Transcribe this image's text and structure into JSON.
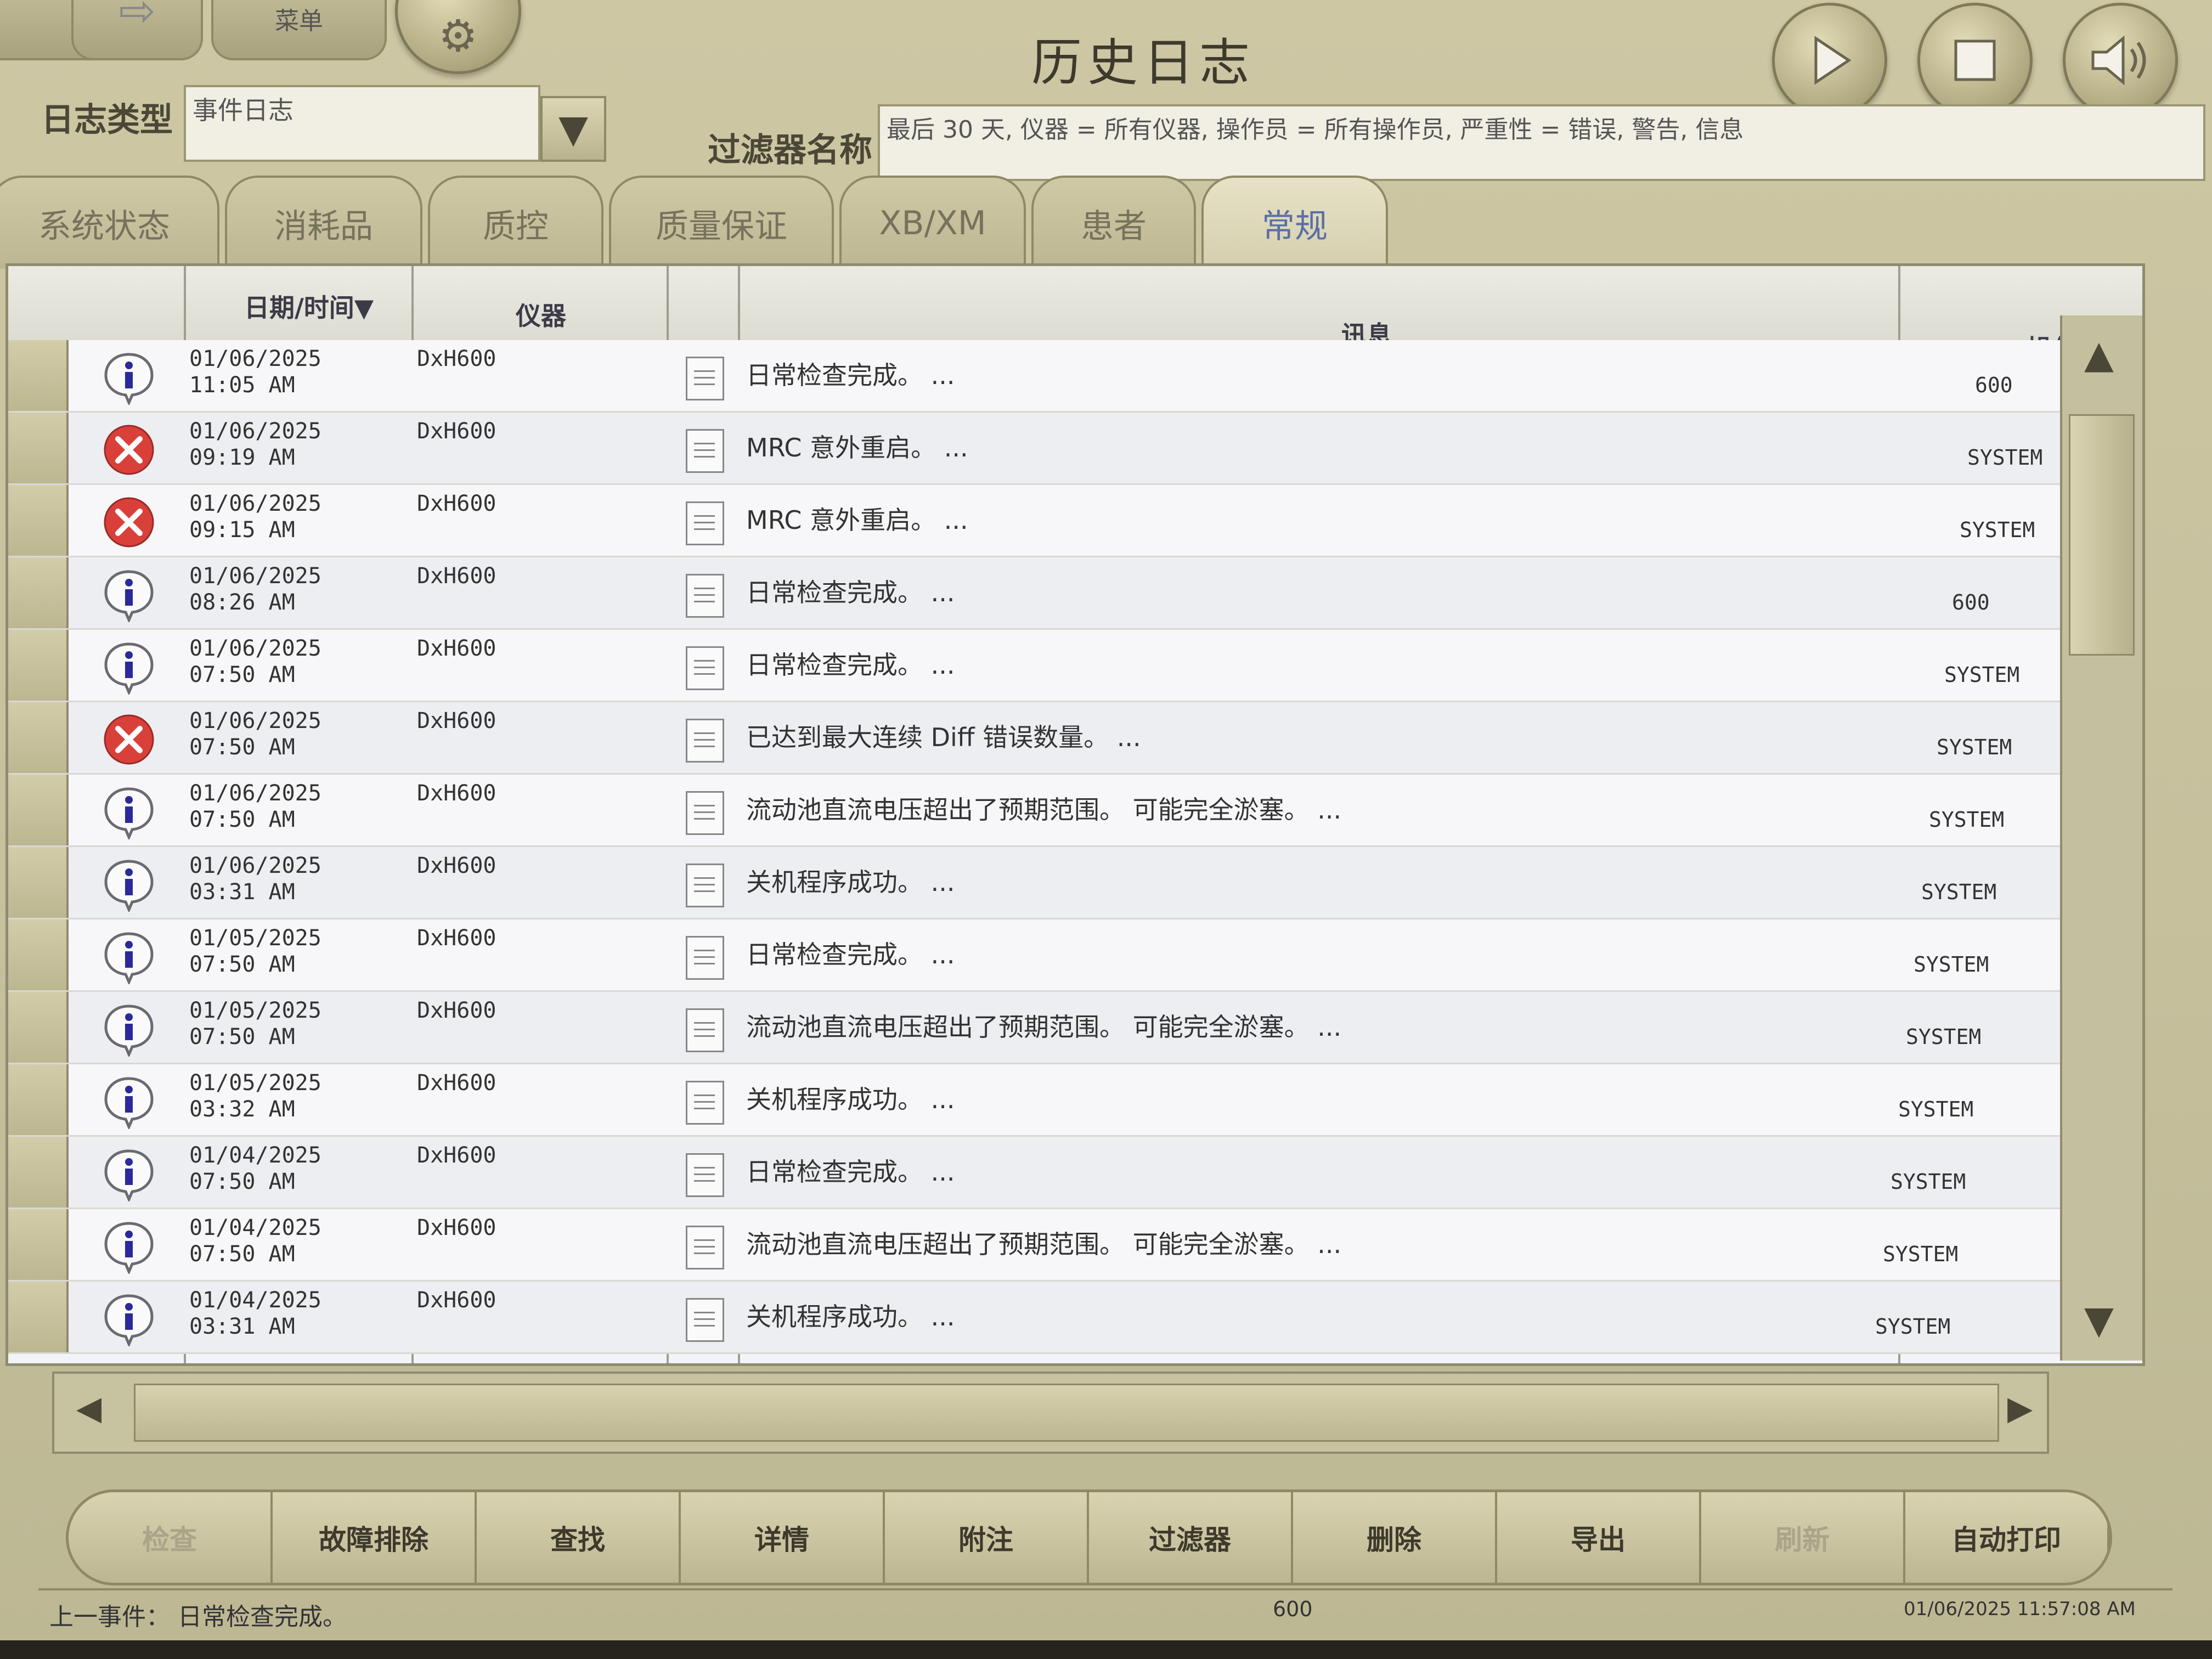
{
  "header": {
    "title": "历史日志",
    "menu_partial_label": "菜单",
    "log_type_label": "日志类型",
    "log_type_value": "事件日志",
    "filter_name_label": "过滤器名称",
    "filter_value": "最后 30 天, 仪器 = 所有仪器, 操作员 = 所有操作员, 严重性 = 错误, 警告, 信息"
  },
  "tabs": [
    {
      "label": "系统状态"
    },
    {
      "label": "消耗品"
    },
    {
      "label": "质控"
    },
    {
      "label": "质量保证"
    },
    {
      "label": "XB/XM"
    },
    {
      "label": "患者"
    },
    {
      "label": "常规"
    }
  ],
  "table": {
    "columns": {
      "datetime": "日期/时间▼",
      "instrument": "仪器",
      "message": "讯息",
      "operator": "操作员"
    },
    "rows": [
      {
        "severity": "info",
        "date": "01/06/2025",
        "time": "11:05 AM",
        "instrument": "DxH600",
        "message": "日常检查完成。 ...",
        "operator": "600"
      },
      {
        "severity": "error",
        "date": "01/06/2025",
        "time": "09:19 AM",
        "instrument": "DxH600",
        "message": "MRC 意外重启。 ...",
        "operator": "SYSTEM"
      },
      {
        "severity": "error",
        "date": "01/06/2025",
        "time": "09:15 AM",
        "instrument": "DxH600",
        "message": "MRC 意外重启。 ...",
        "operator": "SYSTEM"
      },
      {
        "severity": "info",
        "date": "01/06/2025",
        "time": "08:26 AM",
        "instrument": "DxH600",
        "message": "日常检查完成。 ...",
        "operator": "600"
      },
      {
        "severity": "info",
        "date": "01/06/2025",
        "time": "07:50 AM",
        "instrument": "DxH600",
        "message": "日常检查完成。 ...",
        "operator": "SYSTEM"
      },
      {
        "severity": "error",
        "date": "01/06/2025",
        "time": "07:50 AM",
        "instrument": "DxH600",
        "message": "已达到最大连续 Diff 错误数量。 ...",
        "operator": "SYSTEM"
      },
      {
        "severity": "info",
        "date": "01/06/2025",
        "time": "07:50 AM",
        "instrument": "DxH600",
        "message": "流动池直流电压超出了预期范围。 可能完全淤塞。 ...",
        "operator": "SYSTEM"
      },
      {
        "severity": "info",
        "date": "01/06/2025",
        "time": "03:31 AM",
        "instrument": "DxH600",
        "message": "关机程序成功。 ...",
        "operator": "SYSTEM"
      },
      {
        "severity": "info",
        "date": "01/05/2025",
        "time": "07:50 AM",
        "instrument": "DxH600",
        "message": "日常检查完成。 ...",
        "operator": "SYSTEM"
      },
      {
        "severity": "info",
        "date": "01/05/2025",
        "time": "07:50 AM",
        "instrument": "DxH600",
        "message": "流动池直流电压超出了预期范围。 可能完全淤塞。 ...",
        "operator": "SYSTEM"
      },
      {
        "severity": "info",
        "date": "01/05/2025",
        "time": "03:32 AM",
        "instrument": "DxH600",
        "message": "关机程序成功。 ...",
        "operator": "SYSTEM"
      },
      {
        "severity": "info",
        "date": "01/04/2025",
        "time": "07:50 AM",
        "instrument": "DxH600",
        "message": "日常检查完成。 ...",
        "operator": "SYSTEM"
      },
      {
        "severity": "info",
        "date": "01/04/2025",
        "time": "07:50 AM",
        "instrument": "DxH600",
        "message": "流动池直流电压超出了预期范围。 可能完全淤塞。 ...",
        "operator": "SYSTEM"
      },
      {
        "severity": "info",
        "date": "01/04/2025",
        "time": "03:31 AM",
        "instrument": "DxH600",
        "message": "关机程序成功。 ...",
        "operator": "SYSTEM"
      }
    ]
  },
  "buttons": [
    {
      "label": "检查",
      "enabled": false
    },
    {
      "label": "故障排除",
      "enabled": true
    },
    {
      "label": "查找",
      "enabled": true
    },
    {
      "label": "详情",
      "enabled": true
    },
    {
      "label": "附注",
      "enabled": true
    },
    {
      "label": "过滤器",
      "enabled": true
    },
    {
      "label": "删除",
      "enabled": true
    },
    {
      "label": "导出",
      "enabled": true
    },
    {
      "label": "刷新",
      "enabled": false
    },
    {
      "label": "自动打印",
      "enabled": true
    }
  ],
  "status": {
    "last_event": "上一事件： 日常检查完成。",
    "operator": "600",
    "datetime": "01/06/2025 11:57:08 AM"
  },
  "icons": {
    "play": "play-icon",
    "stop": "stop-icon",
    "volume": "volume-icon",
    "info": "info-icon",
    "error": "error-icon",
    "note": "note-icon"
  },
  "colors": {
    "error": "#d9403a",
    "info_border": "#6a6a72",
    "info_text": "#2a2a9a",
    "active_tab_text": "#5b6fa4"
  }
}
